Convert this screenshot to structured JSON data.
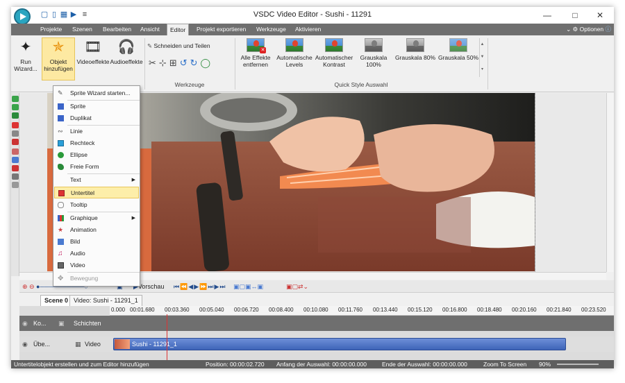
{
  "window": {
    "title": "VSDC Video Editor - Sushi - 11291"
  },
  "menu": {
    "items": [
      "Projekte",
      "Szenen",
      "Bearbeiten",
      "Ansicht",
      "Editor",
      "Projekt exportieren",
      "Werkzeuge",
      "Aktivieren"
    ],
    "active": "Editor",
    "options_label": "Optionen"
  },
  "ribbon": {
    "run_wizard": "Run\nWizard...",
    "add_object": "Objekt\nhinzufügen",
    "video_effects": "Videoeffekte",
    "audio_effects": "Audioeffekte",
    "cut_split": "Schneiden und Teilen",
    "tools_label": "Werkzeuge",
    "quick_style_label": "Quick Style Auswahl",
    "quick_styles": [
      {
        "label": "Alle Effekte\nentfernen",
        "icon": "remove-effects-icon"
      },
      {
        "label": "Automatische\nLevels",
        "icon": "balloon-icon"
      },
      {
        "label": "Automatischer\nKontrast",
        "icon": "balloon-icon"
      },
      {
        "label": "Grauskala\n100%",
        "icon": "balloon-gray-icon"
      },
      {
        "label": "Grauskala 80%",
        "icon": "balloon-gray-icon"
      },
      {
        "label": "Grauskala 50%",
        "icon": "balloon-icon"
      }
    ]
  },
  "dropdown": {
    "items": [
      {
        "label": "Sprite Wizard starten...",
        "icon": "wand-icon"
      },
      {
        "label": "Sprite",
        "icon": "sprite-icon"
      },
      {
        "label": "Duplikat",
        "icon": "duplicate-icon"
      },
      {
        "label": "Linie",
        "icon": "line-icon"
      },
      {
        "label": "Rechteck",
        "icon": "rectangle-icon"
      },
      {
        "label": "Ellipse",
        "icon": "ellipse-icon"
      },
      {
        "label": "Freie Form",
        "icon": "free-form-icon"
      },
      {
        "label": "Text",
        "icon": "text-icon"
      },
      {
        "label": "Untertitel",
        "icon": "subtitle-icon"
      },
      {
        "label": "Tooltip",
        "icon": "tooltip-icon"
      },
      {
        "label": "Graphique",
        "icon": "graphic-icon"
      },
      {
        "label": "Animation",
        "icon": "animation-icon"
      },
      {
        "label": "Bild",
        "icon": "image-icon"
      },
      {
        "label": "Audio",
        "icon": "audio-icon"
      },
      {
        "label": "Video",
        "icon": "video-icon"
      },
      {
        "label": "Bewegung",
        "icon": "motion-icon"
      }
    ],
    "highlighted": "Untertitel"
  },
  "timeline": {
    "preview_label": "Vorschau",
    "scene_tab": "Scene 0",
    "video_tab": "Video: Sushi - 11291_1",
    "layers_label": "Schichten",
    "layer_short": "Ko...",
    "video_track_short": "Übe...",
    "video_track_label": "Video",
    "clip_label": "Sushi - 11291_1",
    "ticks": [
      "0.000",
      "00:01.680",
      "00:03.360",
      "00:05.040",
      "00:06.720",
      "00:08.400",
      "00:10.080",
      "00:11.760",
      "00:13.440",
      "00:15.120",
      "00:16.800",
      "00:18.480",
      "00:20.160",
      "00:21.840",
      "00:23.520"
    ]
  },
  "status": {
    "message": "Untertitelobjekt erstellen und zum Editor hinzufügen",
    "position": "Position:  00:00:02.720",
    "selection_start": "Anfang der Auswahl:  00:00:00.000",
    "selection_end": "Ende der Auswahl:  00:00:00.000",
    "zoom_label": "Zoom To Screen",
    "zoom_value": "90%"
  }
}
